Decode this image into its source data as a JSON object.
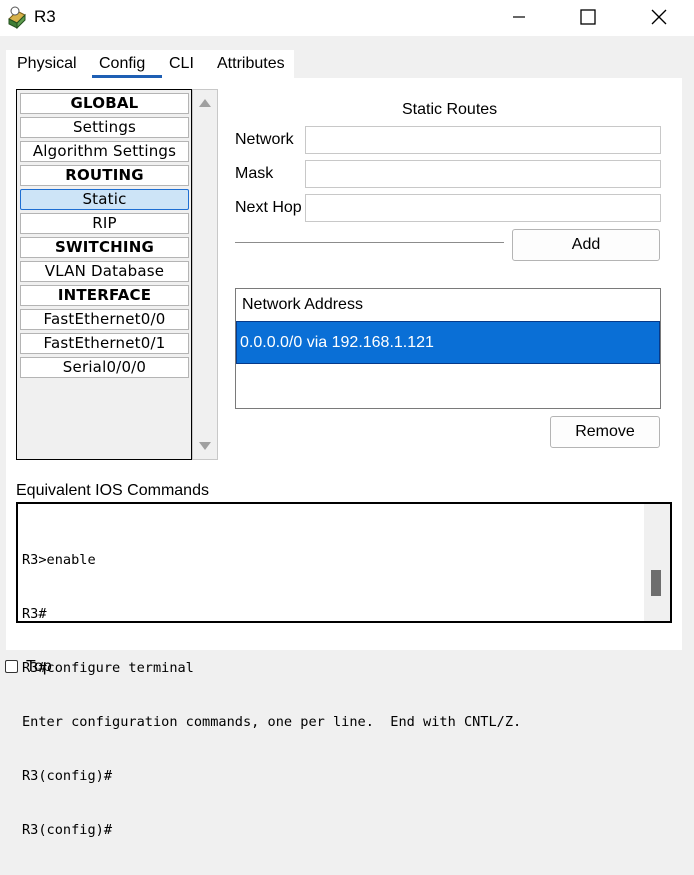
{
  "window": {
    "title": "R3",
    "app_icon": "router-icon",
    "controls": [
      "minimize-icon",
      "maximize-icon",
      "close-icon"
    ]
  },
  "tabs": [
    {
      "label": "Physical",
      "active": false
    },
    {
      "label": "Config",
      "active": true
    },
    {
      "label": "CLI",
      "active": false
    },
    {
      "label": "Attributes",
      "active": false
    }
  ],
  "sidebar": {
    "items": [
      {
        "label": "GLOBAL",
        "header": true
      },
      {
        "label": "Settings"
      },
      {
        "label": "Algorithm Settings"
      },
      {
        "label": "ROUTING",
        "header": true
      },
      {
        "label": "Static",
        "selected": true
      },
      {
        "label": "RIP"
      },
      {
        "label": "SWITCHING",
        "header": true
      },
      {
        "label": "VLAN Database"
      },
      {
        "label": "INTERFACE",
        "header": true
      },
      {
        "label": "FastEthernet0/0"
      },
      {
        "label": "FastEthernet0/1"
      },
      {
        "label": "Serial0/0/0"
      }
    ]
  },
  "static_routes": {
    "title": "Static Routes",
    "network_label": "Network",
    "network_value": "",
    "mask_label": "Mask",
    "mask_value": "",
    "nexthop_label": "Next Hop",
    "nexthop_value": "",
    "add_label": "Add",
    "table_header": "Network Address",
    "routes": [
      "0.0.0.0/0 via 192.168.1.121"
    ],
    "remove_label": "Remove"
  },
  "ios": {
    "label": "Equivalent IOS Commands",
    "lines": [
      "R3>enable",
      "R3#",
      "R3#configure terminal",
      "Enter configuration commands, one per line.  End with CNTL/Z.",
      "R3(config)#",
      "R3(config)#"
    ]
  },
  "footer": {
    "top_label": "Top",
    "top_checked": false
  },
  "colors": {
    "selection": "#0a6fd6",
    "sidebar_selected": "#cde4f7",
    "tab_underline": "#1e5fb4"
  }
}
